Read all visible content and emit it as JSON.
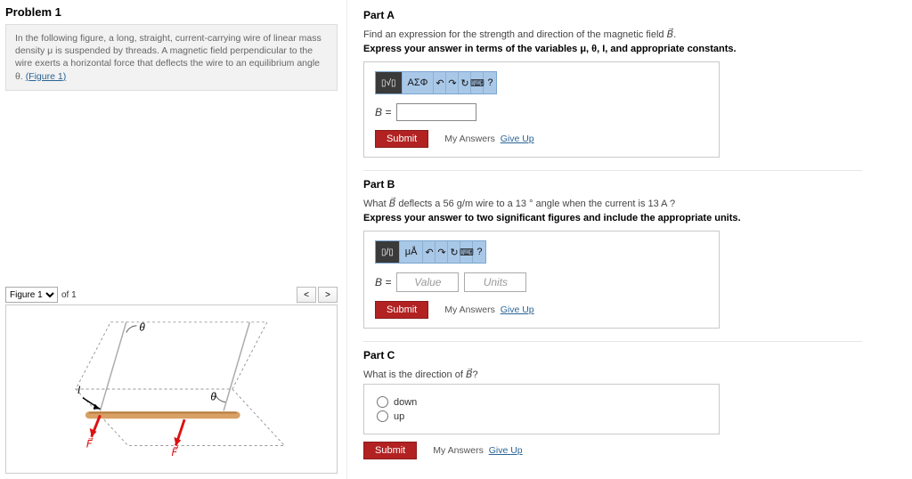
{
  "problem": {
    "title": "Problem 1",
    "intro_text": "In the following figure, a long, straight, current-carrying wire of linear mass density μ is suspended by threads. A magnetic field perpendicular to the wire exerts a horizontal force that deflects the wire to an equilibrium angle θ.",
    "intro_link": "(Figure 1)"
  },
  "figure": {
    "select_label": "Figure 1",
    "of": "of 1",
    "prev": "<",
    "next": ">",
    "labels": {
      "theta1": "θ",
      "theta2": "θ",
      "I": "I",
      "F1": "F⃗",
      "F2": "F⃗"
    }
  },
  "partA": {
    "heading": "Part A",
    "prompt_pre": "Find an expression for the strength and direction of the magnetic field ",
    "prompt_vec": "B⃗",
    "prompt_post": ".",
    "hint": "Express your answer in terms of the variables μ, θ, I, and appropriate constants.",
    "toolbar": {
      "templates": "▯√▯",
      "greek": "ΑΣΦ",
      "undo": "↶",
      "redo": "↷",
      "reset": "↻",
      "keys": "⌨",
      "help": "?"
    },
    "eq_lhs": "B =",
    "submit": "Submit",
    "my_answers": "My Answers",
    "give_up": "Give Up"
  },
  "partB": {
    "heading": "Part B",
    "prompt_pre": "What ",
    "prompt_vec": "B⃗",
    "prompt_mid": " deflects a 56 g/m wire to a 13 ° angle when the current is 13 A ?",
    "hint": "Express your answer to two significant figures and include the appropriate units.",
    "toolbar": {
      "frac": "▯/▯",
      "units": "μÅ",
      "undo": "↶",
      "redo": "↷",
      "reset": "↻",
      "keys": "⌨",
      "help": "?"
    },
    "eq_lhs": "B =",
    "value_ph": "Value",
    "units_ph": "Units",
    "submit": "Submit",
    "my_answers": "My Answers",
    "give_up": "Give Up"
  },
  "partC": {
    "heading": "Part C",
    "prompt_pre": "What is the direction of ",
    "prompt_vec": "B⃗",
    "prompt_post": "?",
    "options": [
      "down",
      "up"
    ],
    "submit": "Submit",
    "my_answers": "My Answers",
    "give_up": "Give Up"
  }
}
